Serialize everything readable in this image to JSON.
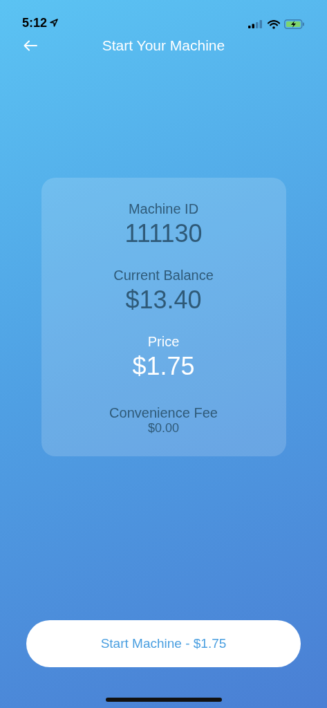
{
  "status_bar": {
    "time": "5:12"
  },
  "header": {
    "title": "Start Your Machine"
  },
  "card": {
    "items": [
      {
        "kind": "large",
        "label": "Machine ID",
        "value": "111130"
      },
      {
        "kind": "large",
        "label": "Current Balance",
        "value": "$13.40"
      },
      {
        "kind": "highlight",
        "label": "Price",
        "value": "$1.75"
      },
      {
        "kind": "small",
        "label": "Convenience Fee",
        "value": "$0.00"
      }
    ]
  },
  "button": {
    "label": "Start Machine - $1.75"
  }
}
